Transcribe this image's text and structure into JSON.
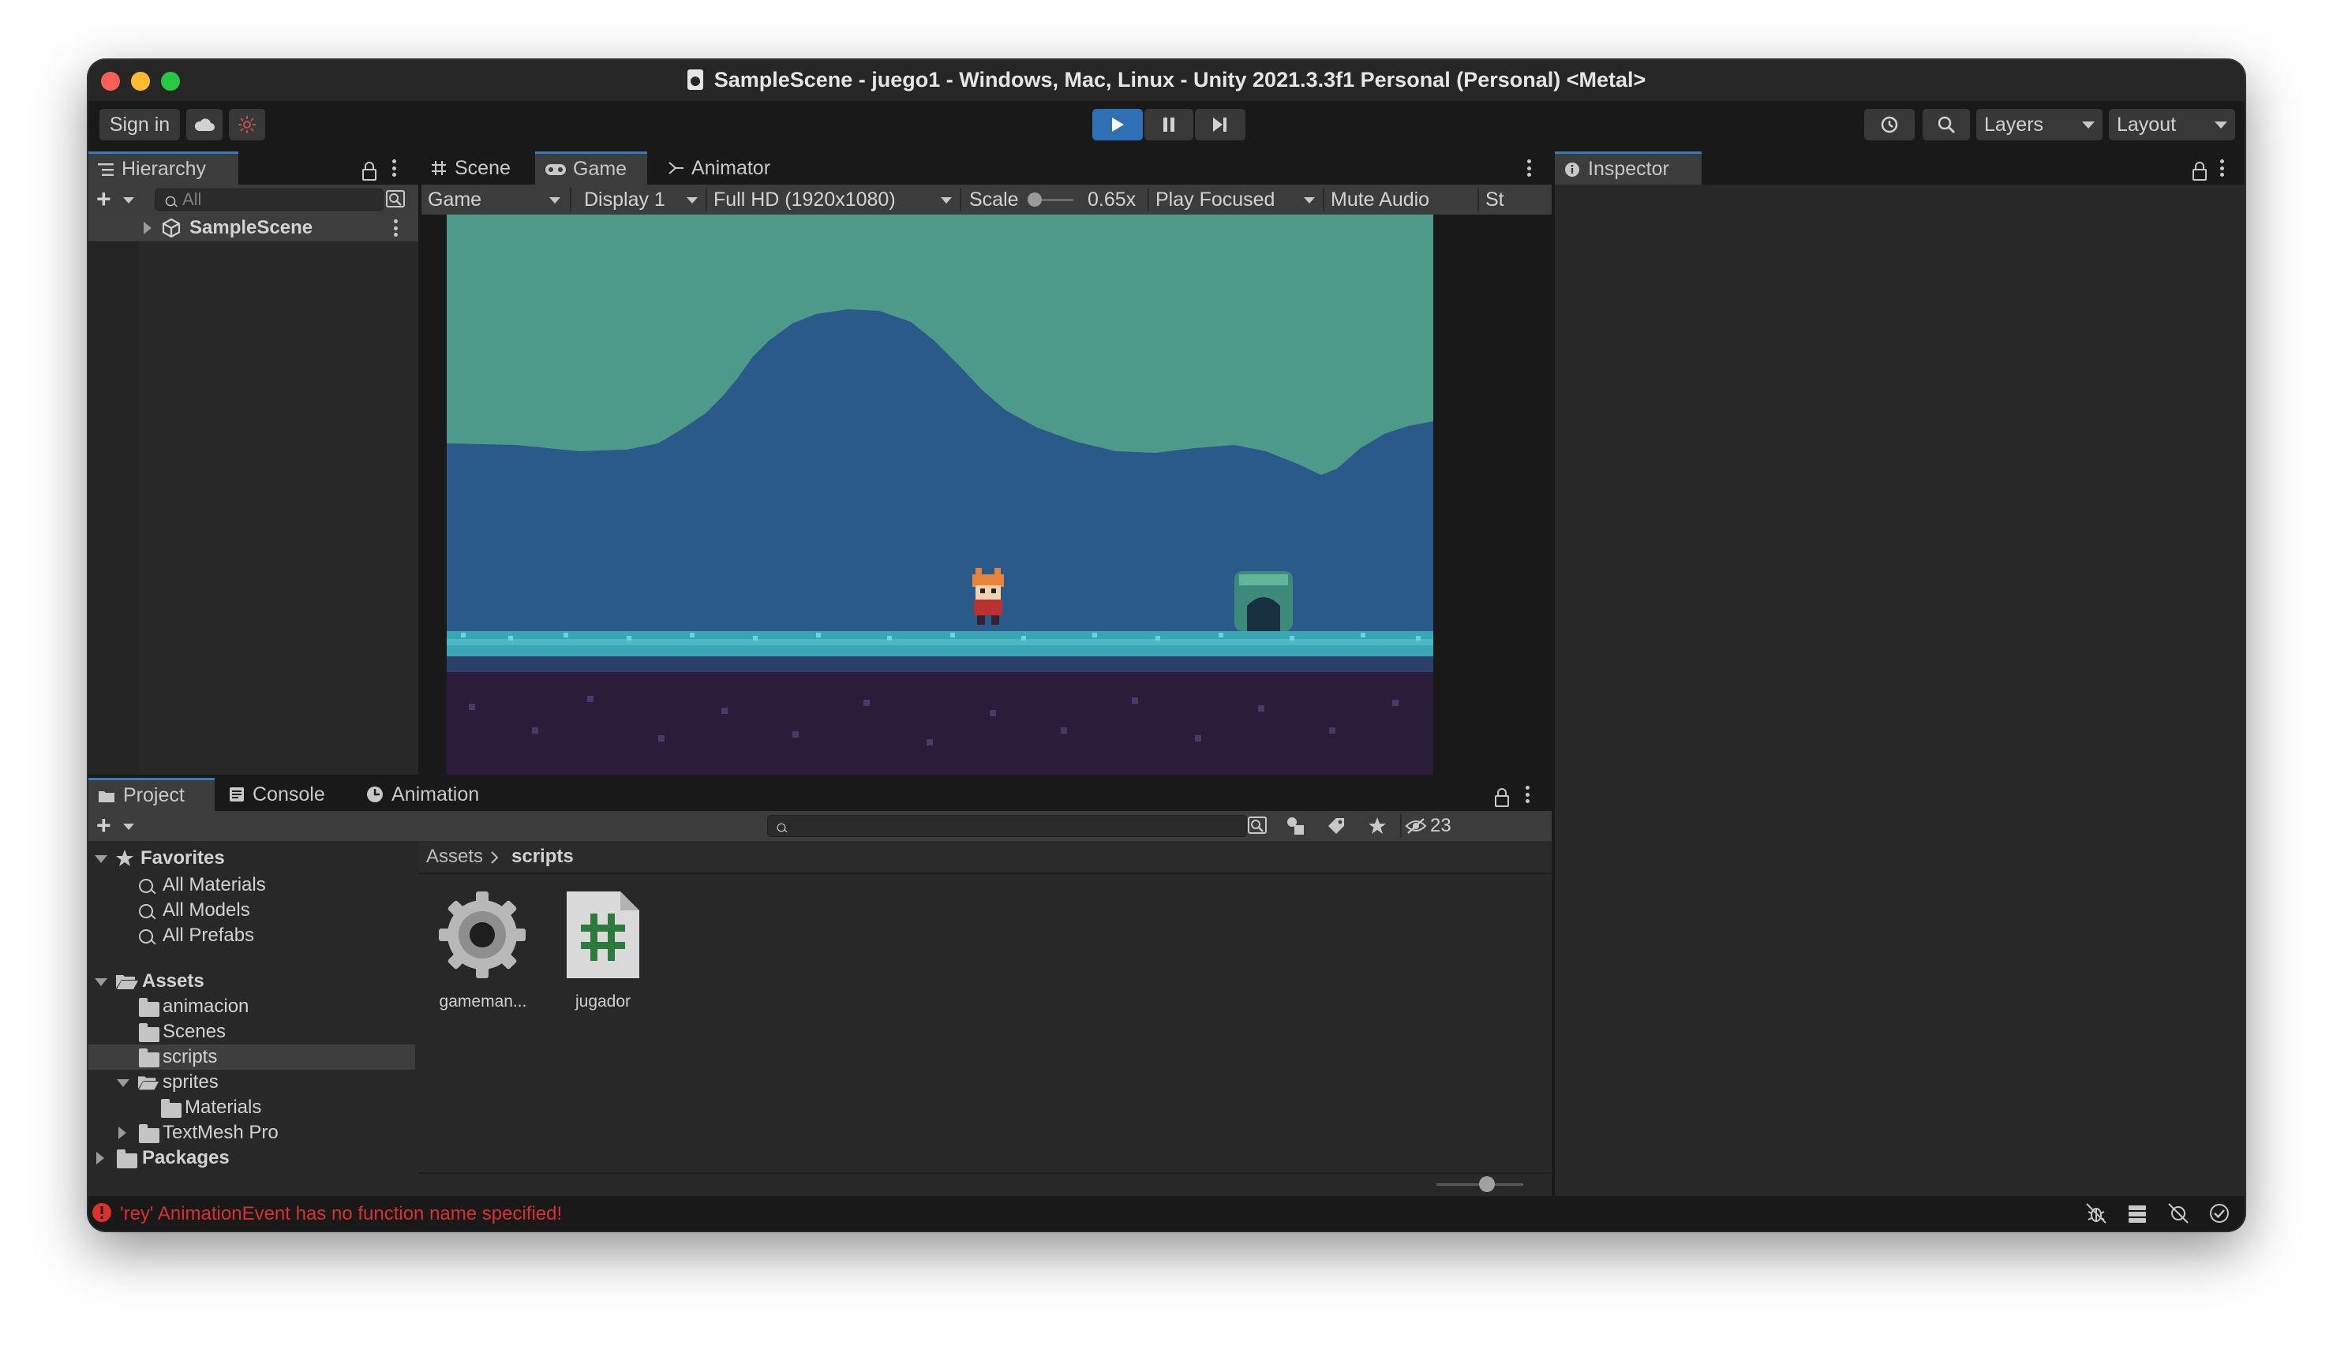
{
  "window": {
    "title": "SampleScene - juego1 - Windows, Mac, Linux - Unity 2021.3.3f1 Personal (Personal) <Metal>"
  },
  "toolbar": {
    "sign_in": "Sign in",
    "layers": "Layers",
    "layout": "Layout"
  },
  "hierarchy": {
    "tab": "Hierarchy",
    "search_placeholder": "All",
    "scene": "SampleScene"
  },
  "scene_tabs": {
    "scene": "Scene",
    "game": "Game",
    "animator": "Animator"
  },
  "game_toolbar": {
    "view": "Game",
    "display": "Display 1",
    "resolution": "Full HD (1920x1080)",
    "scale_label": "Scale",
    "scale_value": "0.65x",
    "play_mode": "Play Focused",
    "mute": "Mute Audio",
    "stats": "St"
  },
  "inspector": {
    "tab": "Inspector"
  },
  "bottom_tabs": {
    "project": "Project",
    "console": "Console",
    "animation": "Animation"
  },
  "project": {
    "hidden_count": "23",
    "favorites": {
      "label": "Favorites",
      "items": [
        "All Materials",
        "All Models",
        "All Prefabs"
      ]
    },
    "assets": {
      "label": "Assets",
      "folders": [
        "animacion",
        "Scenes",
        "scripts",
        "sprites",
        "Materials",
        "TextMesh Pro"
      ]
    },
    "packages": "Packages",
    "breadcrumb": [
      "Assets",
      "scripts"
    ],
    "files": [
      {
        "name": "gameman...",
        "icon": "gear-icon"
      },
      {
        "name": "jugador",
        "icon": "csharp-script-icon"
      }
    ]
  },
  "status": {
    "message": "'rey' AnimationEvent has no function name specified!"
  },
  "colors": {
    "accent_blue": "#2f6fb5",
    "error_red": "#d8322f",
    "sky": "#4e9a8a",
    "hills": "#2a5a8a",
    "ground_top": "#3aa5b5",
    "ground_dark": "#2b1d3a"
  }
}
